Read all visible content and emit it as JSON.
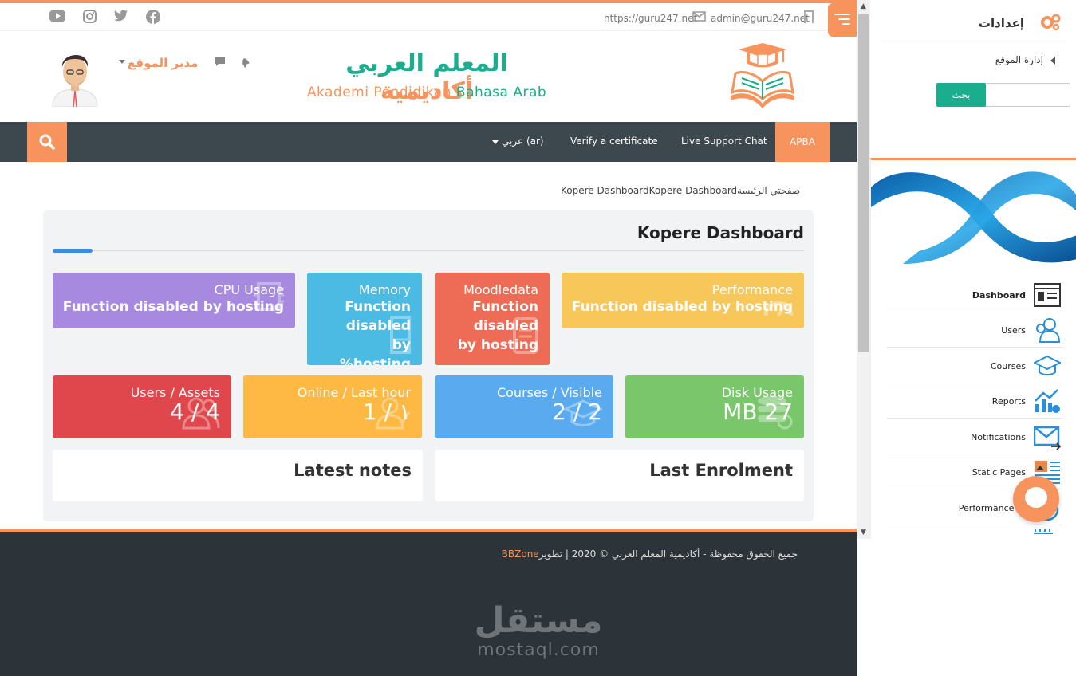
{
  "colors": {
    "accent": "#f7945d",
    "green": "#1bae8e",
    "nav": "#3c474e",
    "footer": "#2d3439"
  },
  "topbar": {
    "url": "https://guru247.net",
    "email": "admin@guru247.net",
    "social": [
      "youtube-icon",
      "instagram-icon",
      "twitter-icon",
      "facebook-icon"
    ]
  },
  "header": {
    "logo_ar_1": "أكاديمية ",
    "logo_ar_2": "المعلم العربي",
    "logo_en_1": "Akademi Pendidikan ",
    "logo_en_2": "Bahasa Arab",
    "user_name": "مدير الموقع"
  },
  "nav": {
    "apba": "APBA",
    "live_chat": "Live Support Chat",
    "verify": "Verify a certificate",
    "language": "عربي (ar)"
  },
  "breadcrumb": {
    "home": "صفحتي الرئيسة",
    "current": "Kopere DashboardKopere Dashboard"
  },
  "dashboard": {
    "title": "Kopere Dashboard",
    "tiles_top": [
      {
        "label": "Performance",
        "value": "Function disabled by hosting"
      },
      {
        "label": "Moodledata",
        "value": "Function disabled by hosting"
      },
      {
        "label": "Memory",
        "value": "Function disabled by %hosting"
      },
      {
        "label": "CPU Usage",
        "value": "Function disabled by hosting"
      }
    ],
    "tiles_bottom": [
      {
        "label": "Disk Usage",
        "value": "MB 27"
      },
      {
        "label": "Courses / Visible",
        "value": "2 / 2"
      },
      {
        "label": "Online / Last hour",
        "value": "1 / ١"
      },
      {
        "label": "Users / Assets",
        "value": "4 / 4"
      }
    ],
    "last_enrolment": "Last Enrolment",
    "latest_notes": "Latest notes"
  },
  "footer": {
    "copyright": "جميع الحقوق محفوظة - أكاديمية المعلم العربي  © 2020 | تطوير",
    "brand": "BBZone",
    "watermark_ar": "مستقل",
    "watermark_en": "mostaql.com"
  },
  "sidebar": {
    "settings_title": "إعدادات",
    "site_admin": "إدارة الموقع",
    "search_button": "بحث",
    "kopere_items": [
      {
        "label": "Dashboard",
        "icon": "dashboard-icon"
      },
      {
        "label": "Users",
        "icon": "users-icon"
      },
      {
        "label": "Courses",
        "icon": "graduation-cap-icon"
      },
      {
        "label": "Reports",
        "icon": "chart-icon"
      },
      {
        "label": "Notifications",
        "icon": "envelope-icon"
      },
      {
        "label": "Static Pages",
        "icon": "pages-icon"
      },
      {
        "label": "Performance te",
        "icon": "gauge-icon"
      }
    ]
  }
}
